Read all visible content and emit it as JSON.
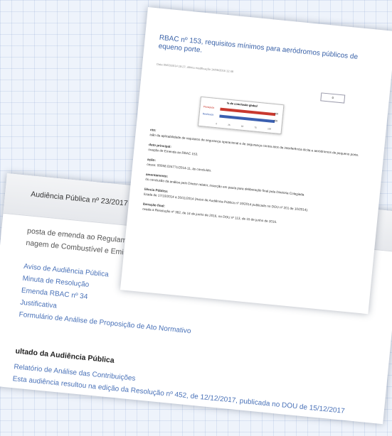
{
  "back": {
    "title": "Audiência Pública nº 23/2017",
    "line1": "posta de emenda ao Regulamento Brasileiro",
    "line2": "nagem de Combustível e Emissões de Escape",
    "links": [
      "Aviso de Audiência Pública",
      "Minuta de Resolução",
      "Emenda RBAC nº 34",
      "Justificativa",
      "Formulário de Análise de Proposição de Ato Normativo"
    ],
    "result_title": "ultado da Audiência Pública",
    "result_links": [
      "Relatório de Análise das Contribuições",
      "Esta audiência resultou na edição da Resolução nº 452, de 12/12/2017, publicada no DOU de 15/12/2017"
    ]
  },
  "front": {
    "head_line1": "RBAC nº 153, requisitos mínimos para aeródromos públicos de",
    "head_line2": "equeno porte.",
    "meta": "Data 05/03/2014 18:27, última modificação 14/06/2016 12:48",
    "pager": "0",
    "chart_title": "% de conclusão global",
    "chart_rows": [
      {
        "label": "Planejada",
        "value": "100",
        "color": "#c8382e"
      },
      {
        "label": "Realizada",
        "value": "100",
        "color": "#3a5fb0"
      }
    ],
    "chart_ticks": [
      "0",
      "25",
      "50",
      "75",
      "100"
    ],
    "sections": [
      {
        "label": "eto:",
        "text": "isão da aplicabilidade de requisitos de segurança operacional e de segurança contra atos de interferência ilícita e aeródromos de pequeno porte."
      },
      {
        "label": "duto principal:",
        "text": "ovação de Emenda ao RBAC 153."
      },
      {
        "label": "ação:",
        "text": "cesso: 00058.024771/2014-11, ás concluído."
      },
      {
        "label": "amentamento:",
        "text": "ós conclusão da análise pelo Diretor relator, inserção em pauta para deliberação final pela Diretoria Colegiada"
      },
      {
        "label": "liência Pública:",
        "text": "lizada de 17/10/2014 a 26/11/2014 (Aviso de Audiência Pública nº 19/2014 publicado no DOU nº 201 de 10/2014)."
      },
      {
        "label": "iberação final:",
        "text": "ovada a Resolução nº 382, de 14 de junho de 2016, no DOU nº 113, de 15 de junho de 2016."
      }
    ]
  }
}
